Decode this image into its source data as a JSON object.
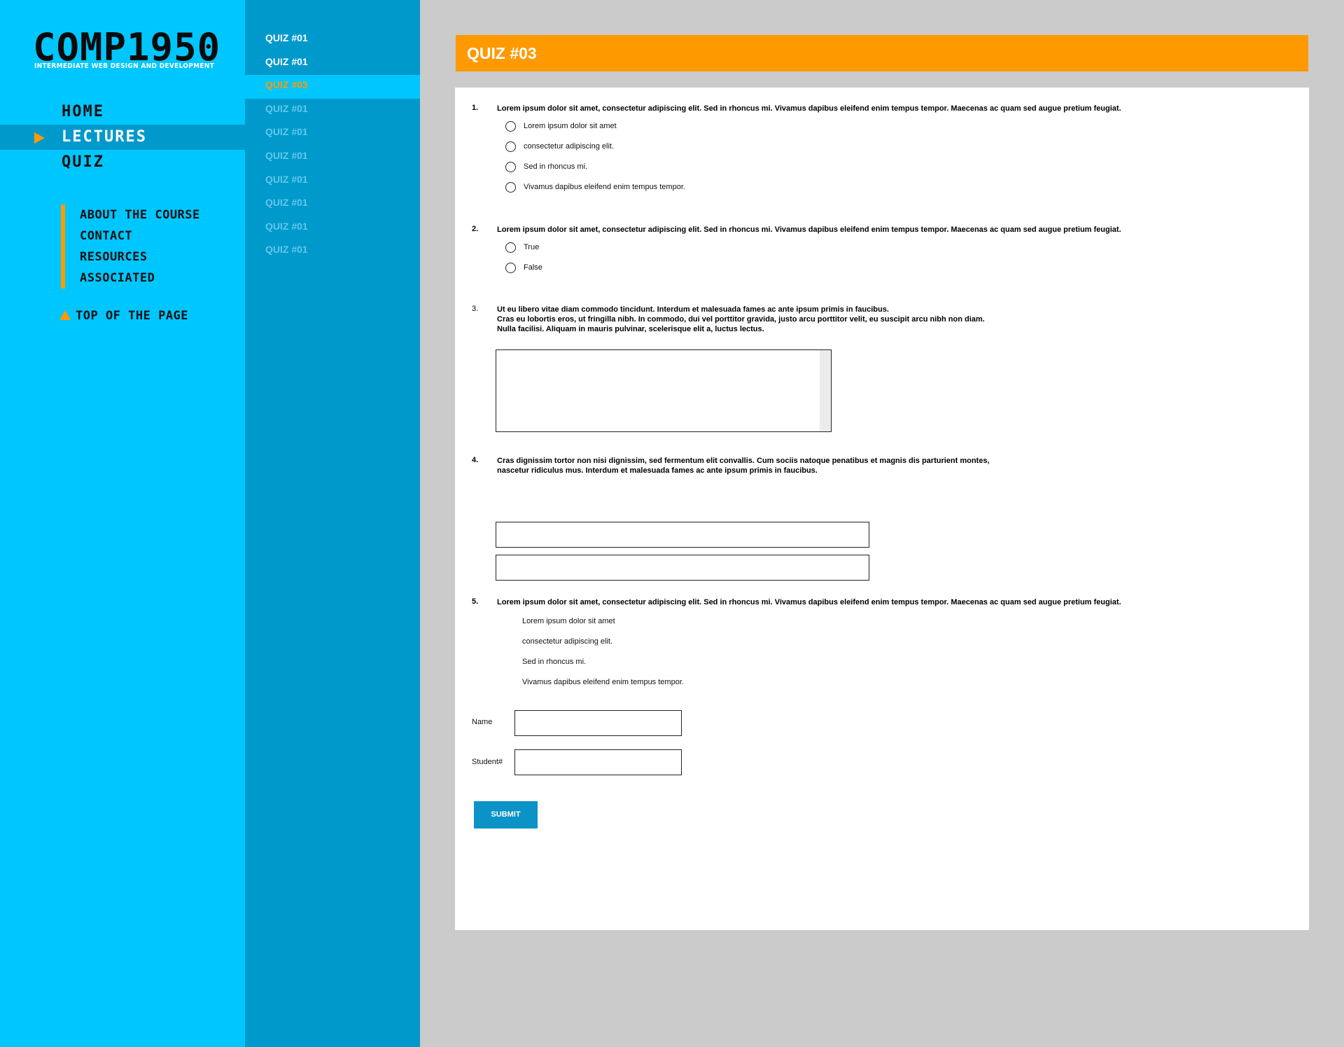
{
  "site": {
    "logo_title": "COMP1950",
    "logo_subtitle": "INTERMEDIATE WEB DESIGN AND DEVELOPMENT"
  },
  "main_nav": {
    "items": [
      {
        "label": "HOME"
      },
      {
        "label": "LECTURES"
      },
      {
        "label": "QUIZ"
      }
    ],
    "active": "LECTURES"
  },
  "sub_nav": {
    "items": [
      {
        "label": "ABOUT THE COURSE"
      },
      {
        "label": "CONTACT"
      },
      {
        "label": "RESOURCES"
      },
      {
        "label": "ASSOCIATED"
      }
    ]
  },
  "top_link": {
    "label": "TOP OF THE PAGE"
  },
  "quiz_list": {
    "items": [
      {
        "label": "QUIZ #01",
        "state": "done"
      },
      {
        "label": "QUIZ #01",
        "state": "done"
      },
      {
        "label": "QUIZ #03",
        "state": "current"
      },
      {
        "label": "QUIZ #01",
        "state": "pending"
      },
      {
        "label": "QUIZ #01",
        "state": "pending"
      },
      {
        "label": "QUIZ #01",
        "state": "pending"
      },
      {
        "label": "QUIZ #01",
        "state": "pending"
      },
      {
        "label": "QUIZ #01",
        "state": "pending"
      },
      {
        "label": "QUIZ #01",
        "state": "pending"
      },
      {
        "label": "QUIZ #01",
        "state": "pending"
      }
    ]
  },
  "page_title": "QUIZ #03",
  "questions": [
    {
      "number": "1.",
      "text": "Lorem ipsum dolor sit amet, consectetur adipiscing elit. Sed in rhoncus mi. Vivamus dapibus eleifend enim tempus tempor. Maecenas ac quam sed augue pretium feugiat.",
      "options": [
        "Lorem ipsum dolor sit amet",
        "consectetur adipiscing elit.",
        "Sed in rhoncus mi.",
        "Vivamus dapibus eleifend enim tempus tempor."
      ]
    },
    {
      "number": "2.",
      "text": "Lorem ipsum dolor sit amet, consectetur adipiscing elit. Sed in rhoncus mi. Vivamus dapibus eleifend enim tempus tempor. Maecenas ac quam sed augue pretium feugiat.",
      "options": [
        "True",
        "False"
      ]
    },
    {
      "number": "3.",
      "lines": [
        "Ut eu libero vitae diam commodo tincidunt. Interdum et malesuada fames ac ante ipsum primis in faucibus.",
        "Cras eu lobortis eros, ut fringilla nibh. In commodo, dui vel porttitor gravida, justo arcu porttitor velit, eu suscipit arcu nibh non diam.",
        "Nulla facilisi. Aliquam in mauris pulvinar, scelerisque elit a, luctus lectus."
      ]
    },
    {
      "number": "4.",
      "lines": [
        "Cras dignissim tortor non nisi dignissim, sed fermentum elit convallis. Cum sociis natoque penatibus et magnis dis parturient montes,",
        "nascetur ridiculus mus. Interdum et malesuada fames ac ante ipsum primis in faucibus."
      ]
    },
    {
      "number": "5.",
      "text": "Lorem ipsum dolor sit amet, consectetur adipiscing elit. Sed in rhoncus mi. Vivamus dapibus eleifend enim tempus tempor. Maecenas ac quam sed augue pretium feugiat.",
      "options": [
        "Lorem ipsum dolor sit amet",
        "consectetur adipiscing elit.",
        "Sed in rhoncus mi.",
        "Vivamus dapibus eleifend enim tempus tempor."
      ]
    }
  ],
  "form": {
    "name_label": "Name",
    "student_label": "Student#",
    "submit_label": "SUBMIT"
  },
  "colors": {
    "sidebar": "#00c6ff",
    "quiz_sidebar": "#0099cc",
    "accent": "#ff9900",
    "button": "#0b93c8"
  }
}
